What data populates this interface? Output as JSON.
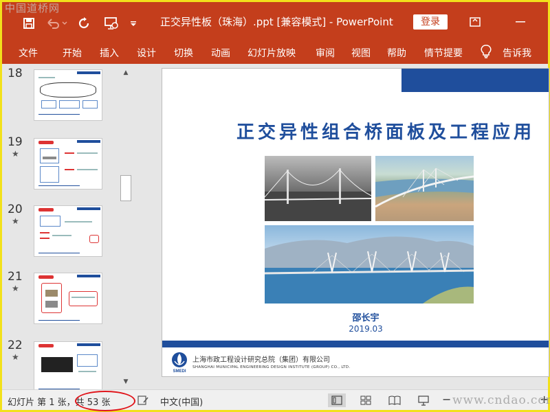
{
  "watermark_top": "中国道桥网",
  "watermark_bottom": "www.cndao.com",
  "window": {
    "title": "正交异性板（珠海）.ppt [兼容模式]  -  PowerPoint",
    "login_label": "登录"
  },
  "qat_icons": [
    "save-icon",
    "undo-icon",
    "redo-icon",
    "present-from-start-icon",
    "customize-qat-icon"
  ],
  "window_controls": [
    "ribbon-display-options-icon",
    "minimize-icon"
  ],
  "ribbon": {
    "tabs": [
      "文件",
      "开始",
      "插入",
      "设计",
      "切换",
      "动画",
      "幻灯片放映",
      "审阅",
      "视图",
      "帮助",
      "情节提要"
    ],
    "tell_me": "告诉我"
  },
  "thumbnails": [
    {
      "number": "18",
      "star": ""
    },
    {
      "number": "19",
      "star": "★"
    },
    {
      "number": "20",
      "star": "★"
    },
    {
      "number": "21",
      "star": "★"
    },
    {
      "number": "22",
      "star": "★"
    }
  ],
  "slide": {
    "title": "正交异性组合桥面板及工程应用",
    "author": "邵长宇",
    "date": "2019.03",
    "org_cn": "上海市政工程设计研究总院（集团）有限公司",
    "org_en": "SHANGHAI MUNICIPAL ENGINEERING DESIGN INSTITUTE (GROUP) CO., LTD.",
    "logo_text": "SMEDI"
  },
  "status": {
    "slide_info": "幻灯片 第 1 张，共 53 张",
    "language": "中文(中国)",
    "zoom_minus": "−",
    "zoom_plus": "+",
    "annotation_color": "#e0141a"
  },
  "colors": {
    "accent": "#c43e1c",
    "slide_blue": "#1f4e9c"
  }
}
